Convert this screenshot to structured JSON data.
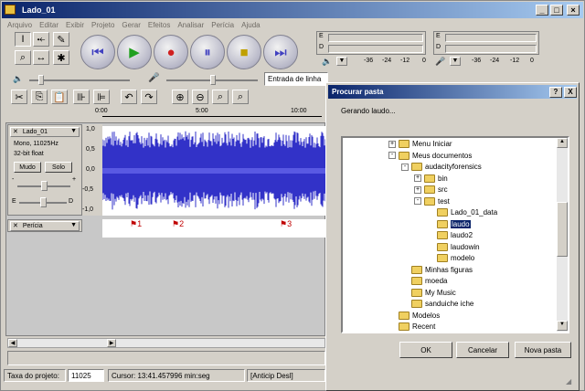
{
  "window": {
    "title": "Lado_01"
  },
  "menu": [
    "Arquivo",
    "Editar",
    "Exibir",
    "Projeto",
    "Gerar",
    "Efeitos",
    "Analisar",
    "Perícia",
    "Ajuda"
  ],
  "meters": {
    "ticks": [
      "-36",
      "-24",
      "-12",
      "0"
    ],
    "left_label": "E",
    "right_label": "D"
  },
  "device": {
    "input_source": "Entrada de linha"
  },
  "ruler": {
    "ticks": [
      "0:00",
      "5:00",
      "10:00"
    ]
  },
  "track": {
    "name": "Lado_01",
    "info1": "Mono, 11025Hz",
    "info2": "32-bit float",
    "mute_label": "Mudo",
    "solo_label": "Solo",
    "pan_left": "E",
    "pan_right": "D",
    "minus": "-",
    "plus": "+",
    "scale": [
      "1,0",
      "0,5",
      "0,0",
      "-0,5",
      "-1,0"
    ]
  },
  "label_track": {
    "name": "Perícia",
    "markers": [
      "1",
      "2",
      "3"
    ]
  },
  "status": {
    "rate_label": "Taxa do projeto:",
    "rate_value": "11025",
    "cursor": "Cursor: 13:41.457996 min:seg",
    "extra": "[Anticip Desl]"
  },
  "dialog": {
    "title": "Procurar pasta",
    "message": "Gerando laudo...",
    "help": "?",
    "close": "X",
    "tree": [
      {
        "label": "Menu Iniciar",
        "level": 0,
        "expander": "+"
      },
      {
        "label": "Meus documentos",
        "level": 0,
        "expander": "-"
      },
      {
        "label": "audacityforensics",
        "level": 1,
        "expander": "-"
      },
      {
        "label": "bin",
        "level": 2,
        "expander": "+"
      },
      {
        "label": "src",
        "level": 2,
        "expander": "+"
      },
      {
        "label": "test",
        "level": 2,
        "expander": "-"
      },
      {
        "label": "Lado_01_data",
        "level": 3,
        "expander": ""
      },
      {
        "label": "laudo",
        "level": 3,
        "expander": "",
        "selected": true
      },
      {
        "label": "laudo2",
        "level": 3,
        "expander": ""
      },
      {
        "label": "laudowin",
        "level": 3,
        "expander": ""
      },
      {
        "label": "modelo",
        "level": 3,
        "expander": ""
      },
      {
        "label": "Minhas figuras",
        "level": 1,
        "expander": ""
      },
      {
        "label": "moeda",
        "level": 1,
        "expander": ""
      },
      {
        "label": "My Music",
        "level": 1,
        "expander": ""
      },
      {
        "label": "sanduiche iche",
        "level": 1,
        "expander": ""
      },
      {
        "label": "Modelos",
        "level": 0,
        "expander": ""
      },
      {
        "label": "Recent",
        "level": 0,
        "expander": ""
      }
    ],
    "ok_label": "OK",
    "cancel_label": "Cancelar",
    "new_folder_label": "Nova pasta"
  },
  "colors": {
    "wave": "#3232c8",
    "selection": "#0a246a",
    "marker": "#c00000"
  }
}
